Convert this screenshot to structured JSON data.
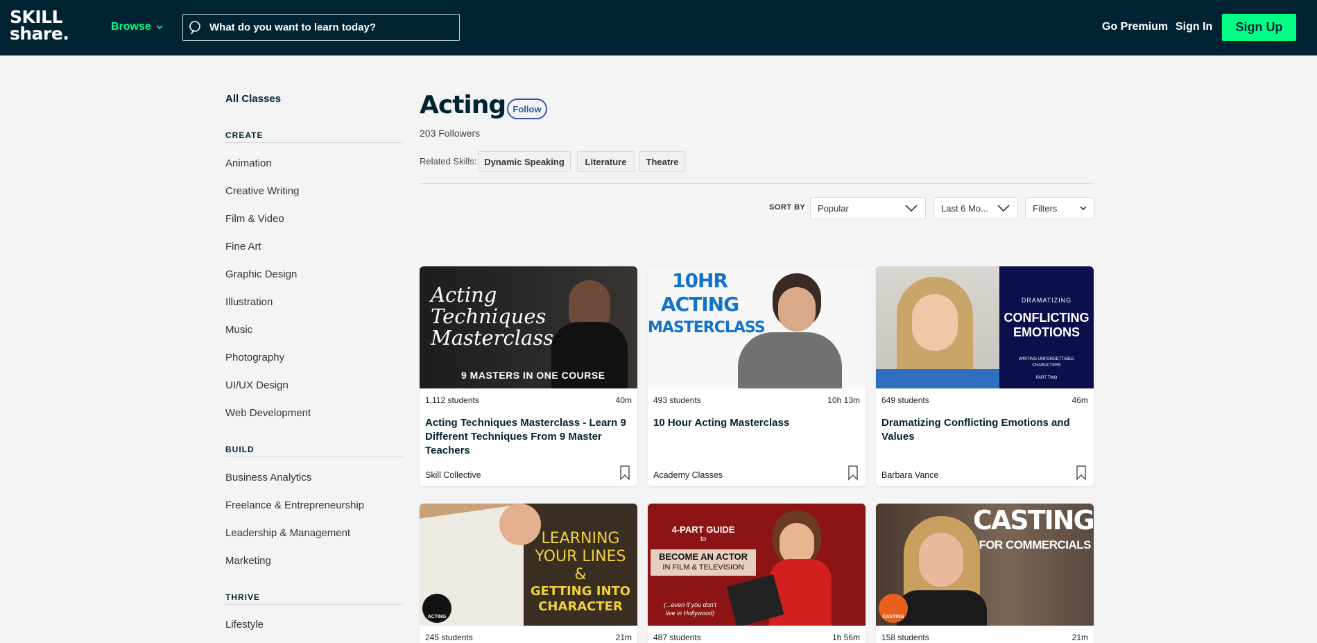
{
  "header": {
    "logo_line1": "SKILL",
    "logo_line2": "share.",
    "browse_label": "Browse",
    "search_placeholder": "What do you want to learn today?",
    "go_premium": "Go Premium",
    "sign_in": "Sign In",
    "sign_up": "Sign Up"
  },
  "sidebar": {
    "all_classes": "All Classes",
    "sections": [
      {
        "title": "CREATE",
        "items": [
          "Animation",
          "Creative Writing",
          "Film & Video",
          "Fine Art",
          "Graphic Design",
          "Illustration",
          "Music",
          "Photography",
          "UI/UX Design",
          "Web Development"
        ]
      },
      {
        "title": "BUILD",
        "items": [
          "Business Analytics",
          "Freelance & Entrepreneurship",
          "Leadership & Management",
          "Marketing"
        ]
      },
      {
        "title": "THRIVE",
        "items": [
          "Lifestyle"
        ]
      }
    ]
  },
  "main": {
    "title": "Acting",
    "follow_label": "Follow",
    "followers": "203 Followers",
    "related_label": "Related Skills:",
    "related": [
      "Dynamic Speaking",
      "Literature",
      "Theatre"
    ],
    "sort_by_label": "SORT BY",
    "sort_value": "Popular",
    "time_value": "Last 6 Mo...",
    "filters_label": "Filters"
  },
  "cards": [
    {
      "students": "1,112 students",
      "duration": "40m",
      "title": "Acting Techniques Masterclass - Learn 9 Different Techniques From 9 Master Teachers",
      "teacher": "Skill Collective",
      "thumb_lines": [
        "Acting",
        "Techniques",
        "Masterclass"
      ],
      "thumb_caption": "9 MASTERS IN ONE COURSE"
    },
    {
      "students": "493 students",
      "duration": "10h 13m",
      "title": "10 Hour Acting Masterclass",
      "teacher": "Academy Classes",
      "thumb_lines": [
        "10HR",
        "ACTING",
        "MASTERCLASS"
      ]
    },
    {
      "students": "649 students",
      "duration": "46m",
      "title": "Dramatizing Conflicting Emotions and Values",
      "teacher": "Barbara Vance",
      "thumb_small": "DRAMATIZING",
      "thumb_lines": [
        "CONFLICTING",
        "EMOTIONS"
      ],
      "thumb_sub1": "WRITING UNFORGETTABLE",
      "thumb_sub2": "CHARACTERS",
      "thumb_part": "PART TWO"
    },
    {
      "students": "245 students",
      "duration": "21m",
      "thumb_lines": [
        "LEARNING",
        "YOUR LINES",
        "&",
        "GETTING INTO",
        "CHARACTER"
      ],
      "thumb_badge": "ACTING"
    },
    {
      "students": "487 students",
      "duration": "1h 56m",
      "thumb_lines": [
        "4-PART GUIDE",
        "to",
        "BECOME AN ACTOR",
        "IN FILM & TELEVISION"
      ],
      "thumb_note1": "(...even if you don't",
      "thumb_note2": "live in Hollywood)"
    },
    {
      "students": "158 students",
      "duration": "21m",
      "thumb_lines": [
        "CASTING",
        "FOR COMMERCIALS"
      ],
      "thumb_badge": "CASTING"
    }
  ],
  "colors": {
    "navy": "#002333",
    "green": "#00ff84",
    "follow_blue": "#3658a9"
  }
}
